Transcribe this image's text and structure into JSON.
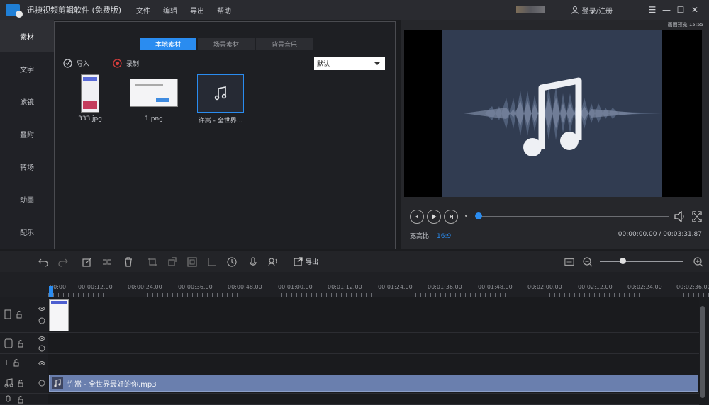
{
  "titlebar": {
    "title": "迅捷视频剪辑软件 (免费版)",
    "menu": [
      "文件",
      "编辑",
      "导出",
      "帮助"
    ],
    "user_label": "登录/注册"
  },
  "sidebar": {
    "items": [
      {
        "label": "素材",
        "active": true
      },
      {
        "label": "文字",
        "active": false
      },
      {
        "label": "滤镜",
        "active": false
      },
      {
        "label": "叠附",
        "active": false
      },
      {
        "label": "转场",
        "active": false
      },
      {
        "label": "动画",
        "active": false
      },
      {
        "label": "配乐",
        "active": false
      }
    ]
  },
  "media": {
    "tabs": [
      "本地素材",
      "场景素材",
      "背景音乐"
    ],
    "import_label": "导入",
    "record_label": "录制",
    "sort_value": "默认",
    "files": [
      {
        "name": "333.jpg",
        "type": "image"
      },
      {
        "name": "1.png",
        "type": "image"
      },
      {
        "name": "许嵩 - 全世界...",
        "type": "audio"
      }
    ]
  },
  "preview": {
    "clock": "画面预览 15:55",
    "ratio_label": "宽高比:",
    "ratio_value": "16:9",
    "timecode": "00:00:00.00 / 00:03:31.87"
  },
  "timeline": {
    "export_label": "导出",
    "ruler": [
      "00:00",
      "00:00:12.00",
      "00:00:24.00",
      "00:00:36.00",
      "00:00:48.00",
      "00:01:00.00",
      "00:01:12.00",
      "00:01:24.00",
      "00:01:36.00",
      "00:01:48.00",
      "00:02:00.00",
      "00:02:12.00",
      "00:02:24.00",
      "00:02:36.00"
    ],
    "audio_clip_name": "许嵩 - 全世界最好的你.mp3"
  },
  "colors": {
    "accent": "#2a8cf0",
    "audio_clip": "#6a7fae"
  }
}
